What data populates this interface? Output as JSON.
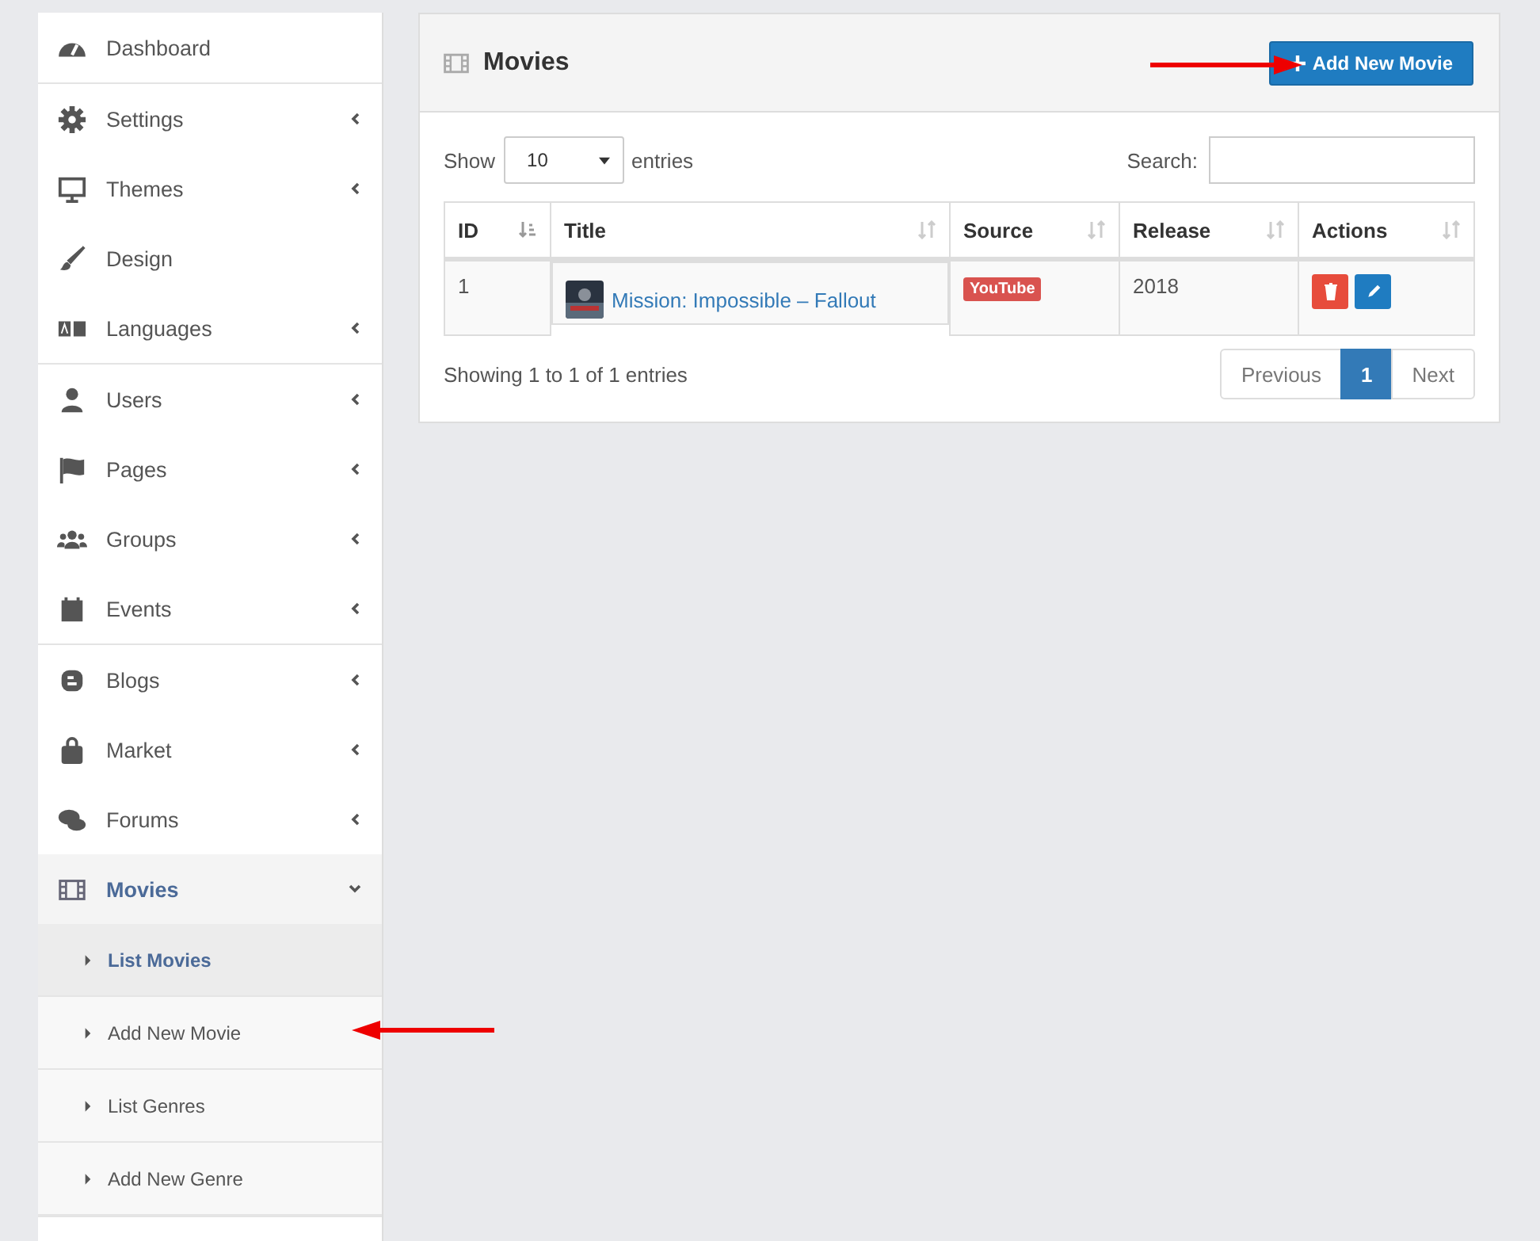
{
  "sidebar": {
    "groups": [
      {
        "items": [
          {
            "label": "Dashboard",
            "has_submenu": false,
            "expanded": false
          }
        ]
      },
      {
        "items": [
          {
            "label": "Settings",
            "has_submenu": true,
            "expanded": false
          },
          {
            "label": "Themes",
            "has_submenu": true,
            "expanded": false
          },
          {
            "label": "Design",
            "has_submenu": false,
            "expanded": false
          },
          {
            "label": "Languages",
            "has_submenu": true,
            "expanded": false
          }
        ]
      },
      {
        "items": [
          {
            "label": "Users",
            "has_submenu": true,
            "expanded": false
          },
          {
            "label": "Pages",
            "has_submenu": true,
            "expanded": false
          },
          {
            "label": "Groups",
            "has_submenu": true,
            "expanded": false
          },
          {
            "label": "Events",
            "has_submenu": true,
            "expanded": false
          }
        ]
      },
      {
        "items": [
          {
            "label": "Blogs",
            "has_submenu": true,
            "expanded": false
          },
          {
            "label": "Market",
            "has_submenu": true,
            "expanded": false
          },
          {
            "label": "Forums",
            "has_submenu": true,
            "expanded": false
          },
          {
            "label": "Movies",
            "has_submenu": true,
            "expanded": true,
            "children": [
              {
                "label": "List Movies",
                "selected": true
              },
              {
                "label": "Add New Movie",
                "selected": false
              },
              {
                "label": "List Genres",
                "selected": false
              },
              {
                "label": "Add New Genre",
                "selected": false
              }
            ]
          }
        ]
      }
    ]
  },
  "panel": {
    "title": "Movies",
    "add_button": "Add New Movie",
    "length": {
      "label_before": "Show",
      "value": "10",
      "label_after": "entries"
    },
    "search": {
      "label": "Search:"
    },
    "table": {
      "columns": [
        {
          "label": "ID",
          "sorted": true
        },
        {
          "label": "Title",
          "sorted": false
        },
        {
          "label": "Source",
          "sorted": false
        },
        {
          "label": "Release",
          "sorted": false
        },
        {
          "label": "Actions",
          "sorted": false
        }
      ],
      "rows": [
        {
          "id": "1",
          "title": "Mission: Impossible – Fallout",
          "source": "YouTube",
          "release": "2018"
        }
      ]
    },
    "info": "Showing 1 to 1 of 1 entries",
    "pagination": [
      {
        "label": "Previous",
        "selected": false
      },
      {
        "label": "1",
        "selected": true
      },
      {
        "label": "Next",
        "selected": false
      }
    ]
  }
}
